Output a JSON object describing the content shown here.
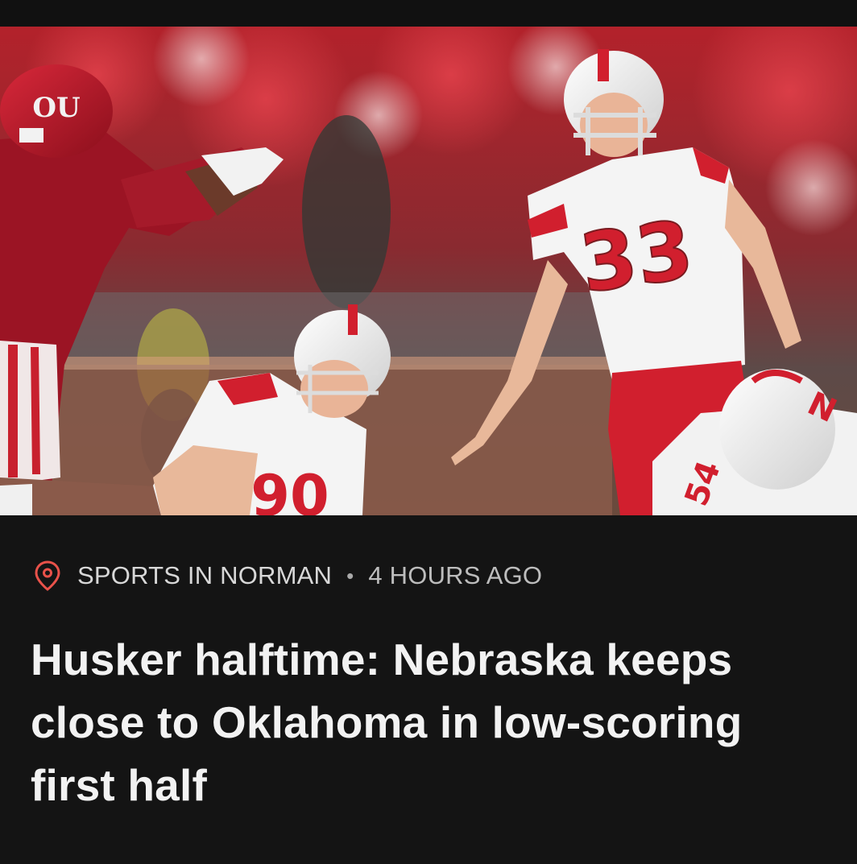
{
  "article": {
    "location": "SPORTS IN NORMAN",
    "separator": "•",
    "time_ago": "4 HOURS AGO",
    "headline": "Husker halftime: Nebraska keeps close to Oklahoma in low-scoring first half",
    "image": {
      "icon": "football-photo",
      "jersey_numbers": [
        "33",
        "90",
        "54"
      ]
    }
  },
  "icons": {
    "location": "location-pin-icon"
  },
  "colors": {
    "background": "#141414",
    "accent": "#e9524a",
    "text_primary": "#f2f2f2",
    "text_secondary": "#d8d8d8"
  }
}
